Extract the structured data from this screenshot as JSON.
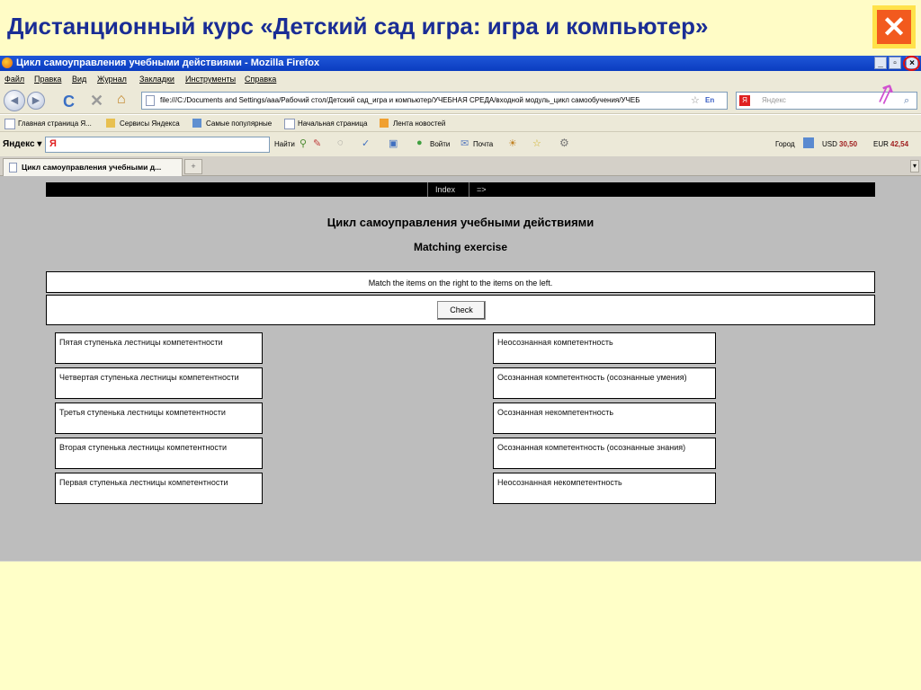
{
  "slide": {
    "title": "Дистанционный курс «Детский сад игра: игра и компьютер»",
    "close_label": "✕"
  },
  "window": {
    "title": "Цикл самоуправления учебными действиями - Mozilla Firefox",
    "min": "_",
    "max": "▫",
    "close": "×"
  },
  "menu": [
    "Файл",
    "Правка",
    "Вид",
    "Журнал",
    "Закладки",
    "Инструменты",
    "Справка"
  ],
  "navbar": {
    "url": "file:///C:/Documents and Settings/aaa/Рабочий стол/Детский сад_игра и компьютер/УЧЕБНАЯ СРЕДА/входной модуль_цикл самообучения/УЧЕБ",
    "lang": "En",
    "search_placeholder": "Яндекс"
  },
  "bookmarks": [
    "Главная страница Я...",
    "Сервисы Яндекса",
    "Самые популярные",
    "Начальная страница",
    "Лента новостей"
  ],
  "yandex_bar": {
    "logo": "Яндекс",
    "find": "Найти",
    "login": "Войти",
    "mail": "Почта",
    "city": "Город",
    "usd_label": "USD",
    "usd_value": "30,50",
    "eur_label": "EUR",
    "eur_value": "42,54"
  },
  "tab": {
    "title": "Цикл самоуправления учебными д...",
    "new_tab": "+"
  },
  "page": {
    "nav": [
      "Index",
      "=>"
    ],
    "heading": "Цикл самоуправления учебными действиями",
    "subheading": "Matching exercise",
    "instructions": "Match the items on the right to the items on the left.",
    "check_label": "Check",
    "left_items": [
      "Пятая ступенька лестницы компетентности",
      "Четвертая ступенька лестницы компетентности",
      "Третья ступенька лестницы компетентности",
      "Вторая ступенька лестницы компетентности",
      "Первая ступенька лестницы компетентности"
    ],
    "right_items": [
      "Неосознанная компетентность",
      "Осознанная компетентность (осознанные умения)",
      "Осознанная некомпетентность",
      "Осознанная компетентность (осознанные знания)",
      "Неосознанная некомпетентность"
    ]
  },
  "colors": {
    "slide_bg": "#fffcc6",
    "title_blue": "#1a2d95",
    "close_orange": "#f25a1e",
    "viewport_gray": "#bdbdbd"
  }
}
